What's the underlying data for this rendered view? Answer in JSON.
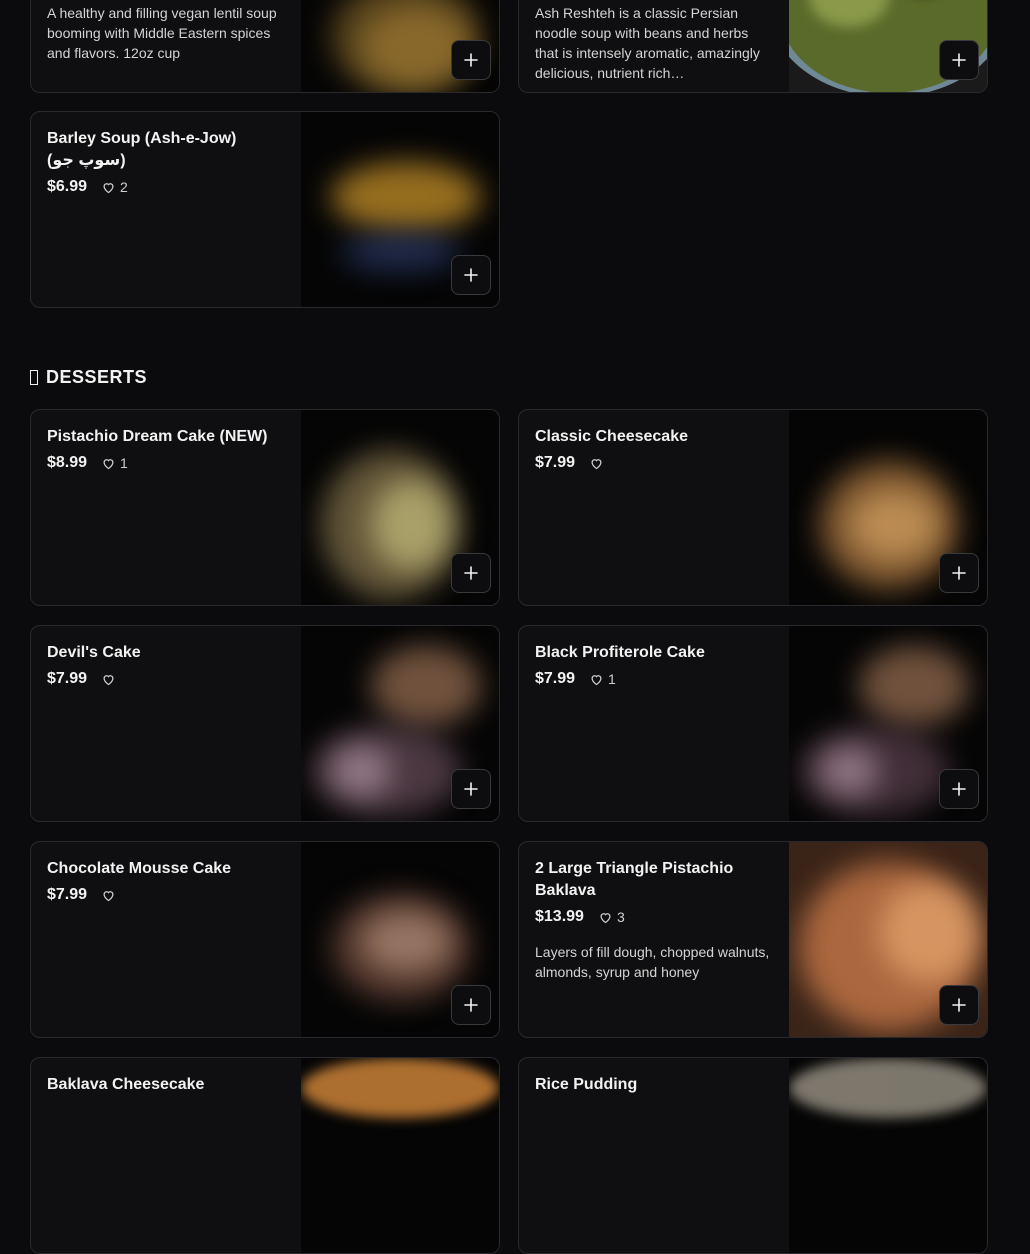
{
  "soups": {
    "lentil": {
      "description": "A healthy and filling vegan lentil soup booming with Middle Eastern spices and flavors. 12oz cup"
    },
    "ash_reshteh": {
      "description": "Ash Reshteh is a classic Persian noodle soup with beans and herbs that is intensely aromatic, amazingly delicious, nutrient rich…"
    },
    "barley": {
      "name": "Barley Soup (Ash-e-Jow) (سوپ جو)",
      "price": "$6.99",
      "likes": "2"
    }
  },
  "desserts_section": {
    "title": "DESSERTS",
    "icon": "unknown-glyph-icon"
  },
  "desserts": {
    "pistachio_dream": {
      "name": "Pistachio Dream Cake (NEW)",
      "price": "$8.99",
      "likes": "1"
    },
    "classic_cheesecake": {
      "name": "Classic Cheesecake",
      "price": "$7.99",
      "likes": ""
    },
    "devils_cake": {
      "name": "Devil's Cake",
      "price": "$7.99",
      "likes": ""
    },
    "black_profiterole": {
      "name": "Black Profiterole Cake",
      "price": "$7.99",
      "likes": "1"
    },
    "chocolate_mousse": {
      "name": "Chocolate Mousse Cake",
      "price": "$7.99",
      "likes": ""
    },
    "baklava": {
      "name": "2 Large Triangle Pistachio Baklava",
      "price": "$13.99",
      "likes": "3",
      "description": "Layers of fill dough, chopped walnuts, almonds, syrup and honey"
    },
    "baklava_cheesecake": {
      "name": "Baklava Cheesecake"
    },
    "rice_pudding": {
      "name": "Rice Pudding"
    }
  },
  "colors": {
    "background": "#0b0b0d",
    "card": "#0f0f11",
    "card_border": "#2a2a2e",
    "text": "#f2f2f2"
  }
}
